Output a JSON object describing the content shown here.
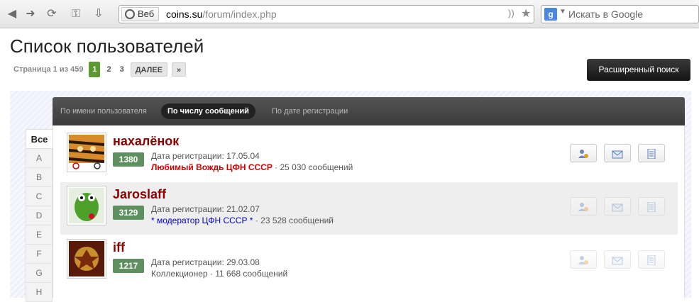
{
  "browser": {
    "web_chip": "Веб",
    "url_host": "coins.su",
    "url_path": "/forum/index.php",
    "search_placeholder": "Искать в Google"
  },
  "page": {
    "title": "Список пользователей",
    "pagination": {
      "label": "Страница 1 из 459",
      "current": "1",
      "pages": [
        "2",
        "3"
      ],
      "next": "ДАЛЕЕ",
      "last": "»"
    },
    "advanced_search": "Расширенный поиск"
  },
  "tabs": [
    {
      "label": "По имени пользователя",
      "active": false
    },
    {
      "label": "По числу сообщений",
      "active": true
    },
    {
      "label": "По дате регистрации",
      "active": false
    }
  ],
  "letters": [
    "Все",
    "A",
    "B",
    "C",
    "D",
    "E",
    "F",
    "G",
    "H"
  ],
  "users": [
    {
      "name": "нахалёнок",
      "posts_badge": "1380",
      "reg": "Дата регистрации: 17.05.04",
      "rank": "Любимый Вождь ЦФН СССР",
      "rank_style": "red",
      "posts": " · 25 030 сообщений",
      "actions_enabled": true
    },
    {
      "name": "Jaroslaff",
      "posts_badge": "3129",
      "reg": "Дата регистрации: 21.02.07",
      "rank": "* модератор ЦФН СССР *",
      "rank_style": "blue",
      "posts": " · 23 528 сообщений",
      "actions_enabled": false
    },
    {
      "name": "iff",
      "posts_badge": "1217",
      "reg": "Дата регистрации: 29.03.08",
      "rank": "Коллекционер",
      "rank_style": "plain",
      "posts": " · 11 668 сообщений",
      "actions_enabled": false
    }
  ],
  "icons": {
    "add_friend": "add-friend-icon",
    "message": "envelope-icon",
    "content": "document-icon"
  },
  "colors": {
    "username": "#8b0000",
    "badge": "#5e8f5e",
    "current_page": "#5a9a2e",
    "rank_red": "#d10000",
    "rank_blue": "#0000cc"
  }
}
